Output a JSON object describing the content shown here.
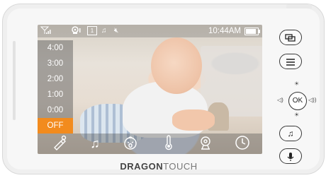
{
  "status_bar": {
    "icons": [
      "signal-icon",
      "camera-count-icon",
      "display-icon",
      "music-icon",
      "mute-icon"
    ],
    "camera_label": "1",
    "time": "10:44AM",
    "battery_level": 0.85
  },
  "timer_menu": {
    "items": [
      "4:00",
      "3:00",
      "2:00",
      "1:00",
      "0:00",
      "OFF"
    ],
    "selected": "OFF"
  },
  "bottom_bar": {
    "icons": [
      "feeding-bottle-icon",
      "music-note-icon",
      "baby-cry-icon",
      "thermometer-icon",
      "camera-icon",
      "clock-icon"
    ]
  },
  "side_controls": {
    "buttons": [
      "switch-screen-icon",
      "menu-icon",
      "volume-brightness-dpad",
      "music-note-icon",
      "microphone-icon"
    ],
    "ok_label": "OK"
  },
  "brand": {
    "part1": "DRAGON",
    "part2": "TOUCH"
  },
  "colors": {
    "accent": "#f28b1e",
    "device": "#f7f7f7"
  }
}
